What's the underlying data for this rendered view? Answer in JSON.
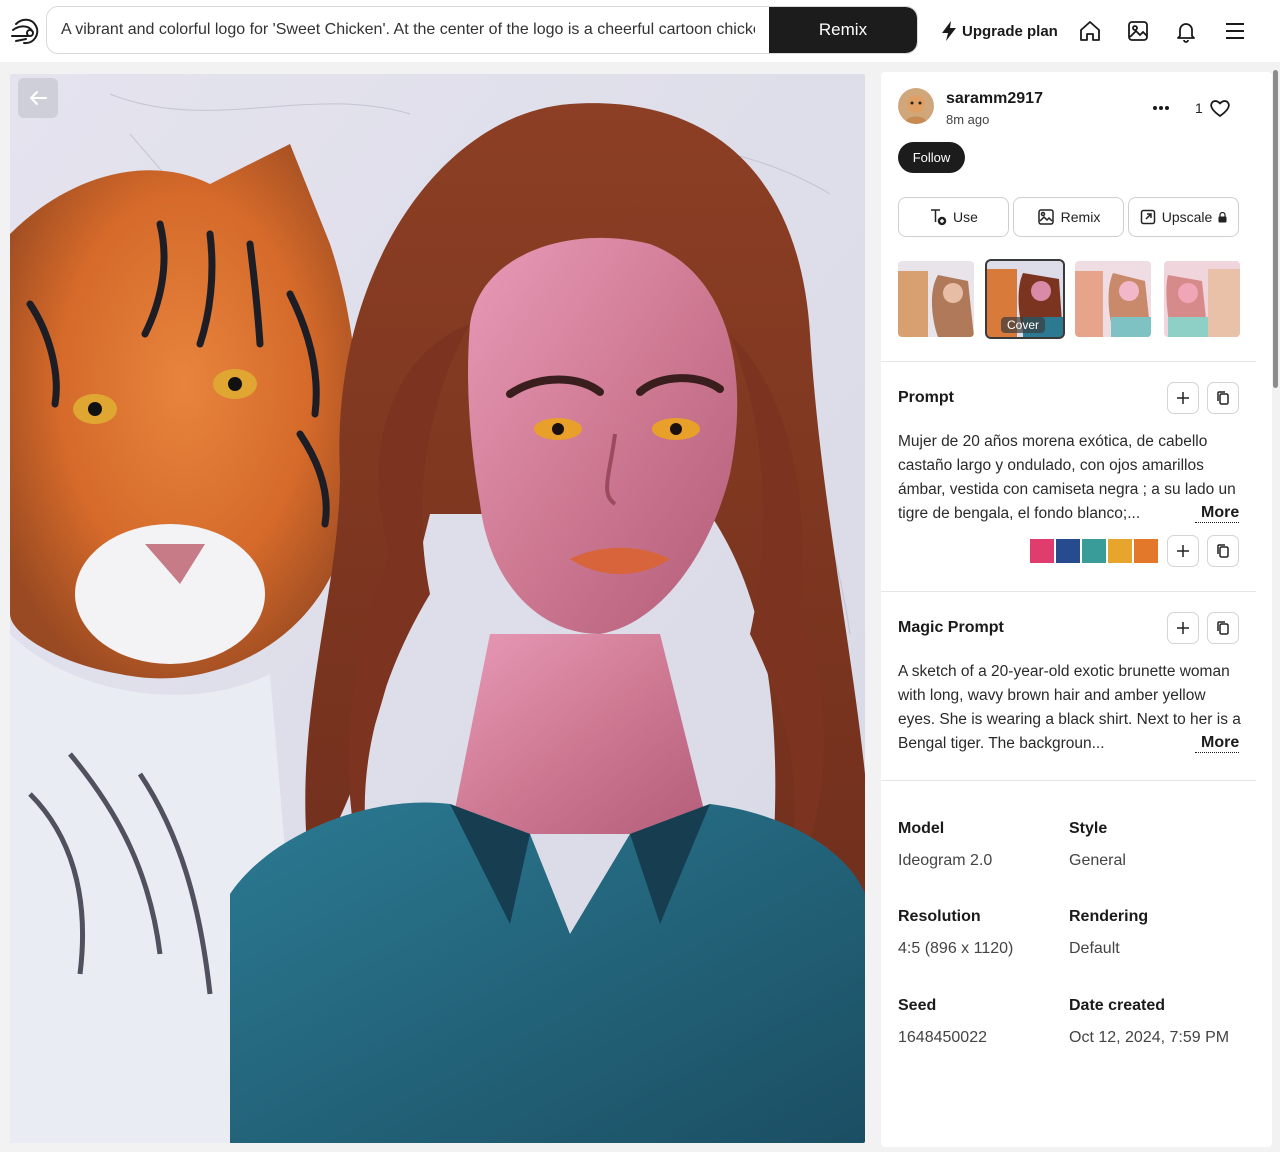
{
  "header": {
    "search_value": "A vibrant and colorful logo for 'Sweet Chicken'. At the center of the logo is a cheerful cartoon chicken",
    "remix_label": "Remix",
    "upgrade_label": "Upgrade plan"
  },
  "post": {
    "username": "saramm2917",
    "time_ago": "8m ago",
    "like_count": "1",
    "follow_label": "Follow",
    "actions": {
      "use": "Use",
      "remix": "Remix",
      "upscale": "Upscale"
    },
    "cover_label": "Cover"
  },
  "prompt": {
    "title": "Prompt",
    "text": "Mujer de 20 años morena exótica, de cabello castaño largo y ondulado, con ojos amarillos ámbar, vestida con camiseta negra ; a su lado un tigre de bengala, el fondo blanco;...",
    "more_label": "More",
    "palette": [
      "#e03d6e",
      "#274b8f",
      "#3a9c99",
      "#e8a52e",
      "#e3782b"
    ]
  },
  "magic_prompt": {
    "title": "Magic Prompt",
    "text": "A sketch of a 20-year-old exotic brunette woman with long, wavy brown hair and amber yellow eyes. She is wearing a black shirt. Next to her is a Bengal tiger. The backgroun...",
    "more_label": "More"
  },
  "details": {
    "model_label": "Model",
    "model_value": "Ideogram 2.0",
    "style_label": "Style",
    "style_value": "General",
    "resolution_label": "Resolution",
    "resolution_value": "4:5 (896 x 1120)",
    "rendering_label": "Rendering",
    "rendering_value": "Default",
    "seed_label": "Seed",
    "seed_value": "1648450022",
    "date_label": "Date created",
    "date_value": "Oct 12, 2024, 7:59 PM"
  }
}
